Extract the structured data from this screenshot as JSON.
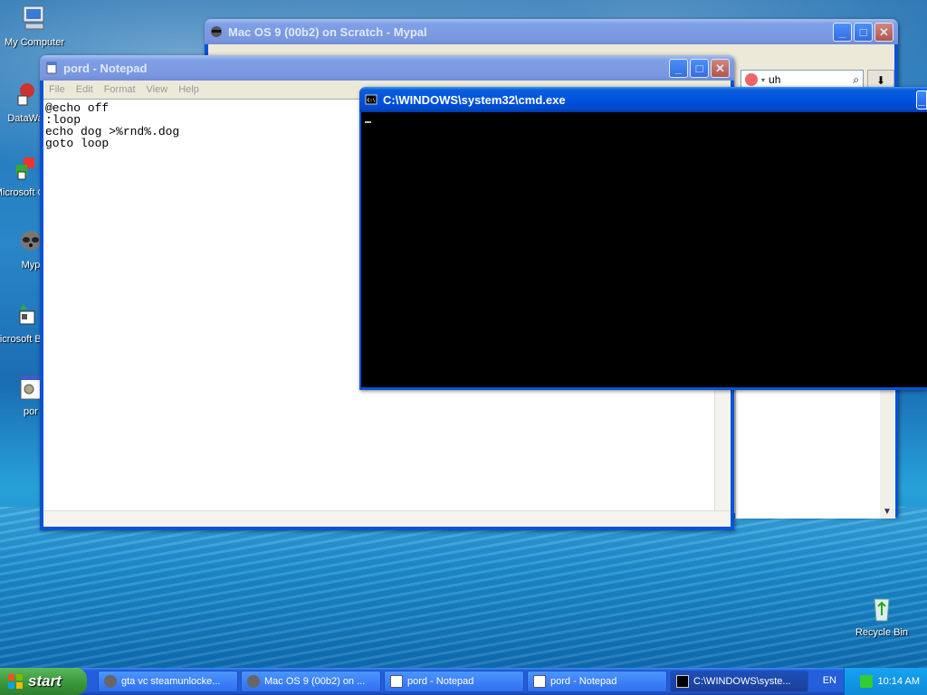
{
  "desktop": {
    "icons": [
      {
        "label": "My Computer"
      },
      {
        "label": "DataWa"
      },
      {
        "label": "Microsoft C++"
      },
      {
        "label": "Myp"
      },
      {
        "label": "Microsoft Basic"
      },
      {
        "label": "por"
      },
      {
        "label": "Recycle Bin"
      }
    ]
  },
  "mypal": {
    "title": "Mac OS 9 (00b2) on Scratch - Mypal",
    "search_value": "uh"
  },
  "notepad": {
    "title": "pord - Notepad",
    "menu": [
      "File",
      "Edit",
      "Format",
      "View",
      "Help"
    ],
    "lines": [
      "@echo off",
      ":loop",
      "echo dog >%rnd%.dog",
      "goto loop"
    ]
  },
  "cmd": {
    "title": "C:\\WINDOWS\\system32\\cmd.exe"
  },
  "taskbar": {
    "start_label": "start",
    "tasks": [
      {
        "label": "gta vc steamunlocke..."
      },
      {
        "label": "Mac OS 9 (00b2) on ..."
      },
      {
        "label": "pord - Notepad"
      },
      {
        "label": "pord - Notepad"
      },
      {
        "label": "C:\\WINDOWS\\syste..."
      }
    ],
    "language": "EN",
    "clock": "10:14 AM"
  }
}
